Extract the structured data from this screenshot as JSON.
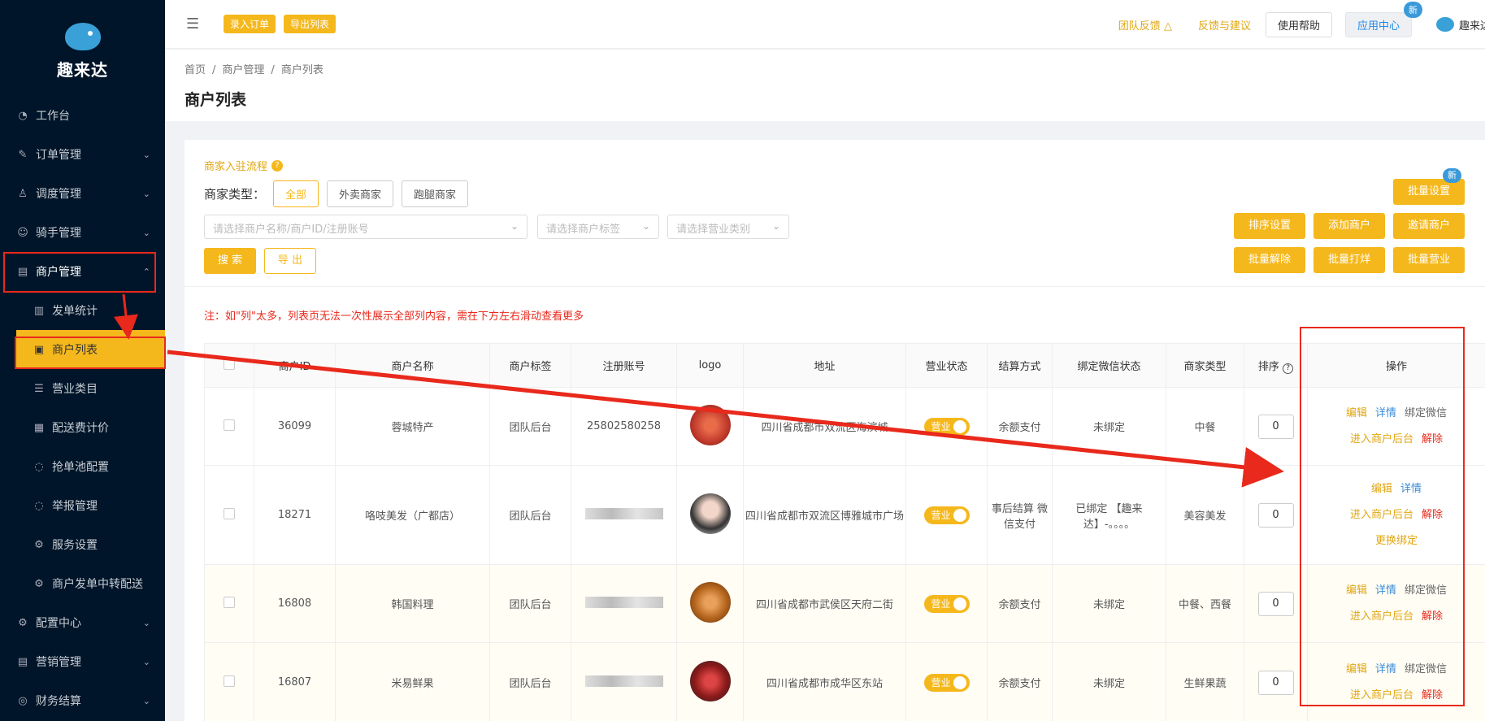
{
  "app": {
    "name": "趣来达"
  },
  "sidebar": {
    "items": [
      {
        "label": "工作台",
        "icon": "dashboard-icon"
      },
      {
        "label": "订单管理",
        "icon": "edit-icon"
      },
      {
        "label": "调度管理",
        "icon": "user-icon"
      },
      {
        "label": "骑手管理",
        "icon": "smile-icon"
      },
      {
        "label": "商户管理",
        "icon": "store-icon"
      },
      {
        "label": "配置中心",
        "icon": "gear-icon"
      },
      {
        "label": "营销管理",
        "icon": "store-icon"
      },
      {
        "label": "财务结算",
        "icon": "wallet-icon"
      }
    ],
    "sub_items": [
      {
        "label": "发单统计",
        "icon": "bar-chart-icon"
      },
      {
        "label": "商户列表",
        "icon": "list-icon"
      },
      {
        "label": "营业类目",
        "icon": "list-icon"
      },
      {
        "label": "配送费计价",
        "icon": "calc-icon"
      },
      {
        "label": "抢单池配置",
        "icon": "circle-icon"
      },
      {
        "label": "举报管理",
        "icon": "circle-icon"
      },
      {
        "label": "服务设置",
        "icon": "gear-icon"
      },
      {
        "label": "商户发单中转配送",
        "icon": "gear-icon"
      }
    ]
  },
  "header": {
    "btn_enter_order": "录入订单",
    "btn_export_list": "导出列表",
    "link_team_feedback": "团队反馈",
    "link_feedback": "反馈与建议",
    "btn_help": "使用帮助",
    "btn_app_center": "应用中心",
    "badge_new": "新",
    "user_name": "趣来达"
  },
  "breadcrumb": [
    "首页",
    "商户管理",
    "商户列表"
  ],
  "page_title": "商户列表",
  "filters": {
    "flow_link": "商家入驻流程",
    "type_label": "商家类型：",
    "types": [
      "全部",
      "外卖商家",
      "跑腿商家"
    ],
    "select_merchant_placeholder": "请选择商户名称/商户ID/注册账号",
    "select_tag_placeholder": "请选择商户标签",
    "select_category_placeholder": "请选择营业类别",
    "search_btn": "搜 索",
    "export_btn": "导 出"
  },
  "actions": {
    "batch_setting": "批量设置",
    "batch_new_badge": "新",
    "sort_setting": "排序设置",
    "add_merchant": "添加商户",
    "invite_merchant": "邀请商户",
    "batch_unbind": "批量解除",
    "batch_close": "批量打烊",
    "batch_open": "批量营业"
  },
  "note": "注：如\"列\"太多，列表页无法一次性展示全部列内容，需在下方左右滑动查看更多",
  "table": {
    "columns": [
      "商户ID",
      "商户名称",
      "商户标签",
      "注册账号",
      "logo",
      "地址",
      "营业状态",
      "结算方式",
      "绑定微信状态",
      "商家类型",
      "排序",
      "操作"
    ],
    "rows": [
      {
        "id": "36099",
        "name": "蓉城特产",
        "tag": "团队后台",
        "account": "25802580258",
        "address": "四川省成都市双流区海滨城",
        "status": "营业",
        "settle": "余额支付",
        "wechat": "未绑定",
        "type": "中餐",
        "sort": "0",
        "logo_color": "#c0392b"
      },
      {
        "id": "18271",
        "name": "咯吱美发（广都店）",
        "tag": "团队后台",
        "account": "",
        "address": "四川省成都市双流区博雅城市广场",
        "status": "营业",
        "settle": "事后结算 微信支付",
        "wechat": "已绑定 【趣来达】-。。。。",
        "type": "美容美发",
        "sort": "0",
        "logo_color": "#555555"
      },
      {
        "id": "16808",
        "name": "韩国料理",
        "tag": "团队后台",
        "account": "",
        "address": "四川省成都市武侯区天府二街",
        "status": "营业",
        "settle": "余额支付",
        "wechat": "未绑定",
        "type": "中餐、西餐",
        "sort": "0",
        "logo_color": "#b5651d"
      },
      {
        "id": "16807",
        "name": "米易鲜果",
        "tag": "团队后台",
        "account": "",
        "address": "四川省成都市成华区东站",
        "status": "营业",
        "settle": "余额支付",
        "wechat": "未绑定",
        "type": "生鲜果蔬",
        "sort": "0",
        "logo_color": "#8b1a1a"
      }
    ],
    "ops": {
      "edit": "编辑",
      "detail": "详情",
      "bind_wechat": "绑定微信",
      "enter_backend": "进入商户后台",
      "unbind": "解除",
      "change_binding": "更换绑定"
    }
  }
}
